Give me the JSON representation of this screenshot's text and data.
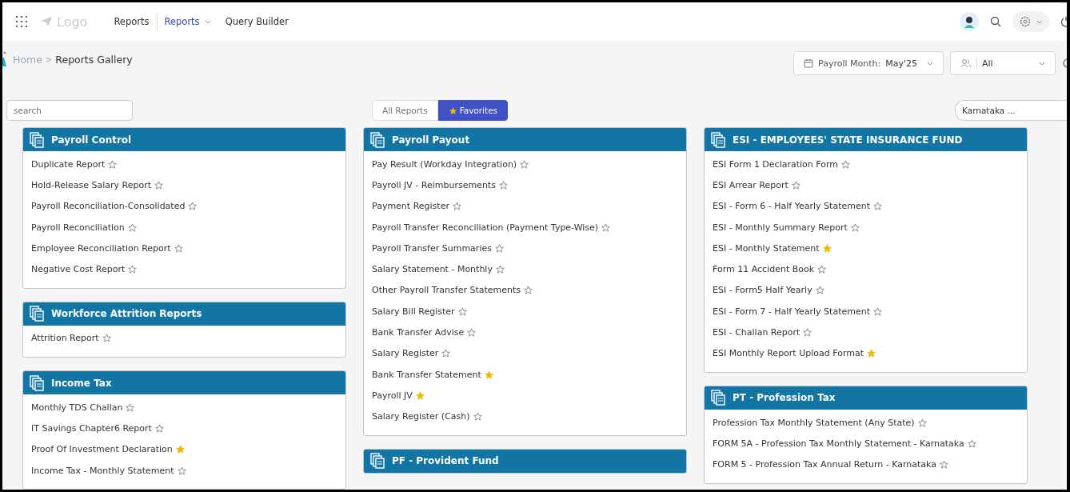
{
  "nav": {
    "logo": "Logo",
    "links": [
      {
        "label": "Reports",
        "selected": false,
        "dropdown": false
      },
      {
        "label": "Reports",
        "selected": true,
        "dropdown": true
      },
      {
        "label": "Query Builder",
        "selected": false,
        "dropdown": false
      }
    ]
  },
  "breadcrumb": {
    "home": "Home",
    "separator": ">",
    "current": "Reports Gallery"
  },
  "filters": {
    "payroll_month_label": "Payroll Month:",
    "payroll_month_value": "May'25",
    "group_value": "All"
  },
  "search": {
    "placeholder": "search"
  },
  "view_tabs": [
    {
      "label": "All Reports",
      "selected": false,
      "star": false
    },
    {
      "label": "Favorites",
      "selected": true,
      "star": true
    }
  ],
  "state_select": {
    "value": "Karnataka ..."
  },
  "columns": [
    [
      {
        "title": "Payroll Control",
        "items": [
          {
            "label": "Duplicate Report",
            "starred": false
          },
          {
            "label": "Hold-Release Salary Report",
            "starred": false
          },
          {
            "label": "Payroll Reconciliation-Consolidated",
            "starred": false
          },
          {
            "label": "Payroll Reconciliation",
            "starred": false
          },
          {
            "label": "Employee Reconciliation Report",
            "starred": false
          },
          {
            "label": "Negative Cost Report",
            "starred": false
          }
        ]
      },
      {
        "title": "Workforce Attrition Reports",
        "items": [
          {
            "label": "Attrition Report",
            "starred": false
          }
        ]
      },
      {
        "title": "Income Tax",
        "items": [
          {
            "label": "Monthly TDS Challan",
            "starred": false
          },
          {
            "label": "IT Savings Chapter6 Report",
            "starred": false
          },
          {
            "label": "Proof Of Investment Declaration",
            "starred": true
          },
          {
            "label": "Income Tax - Monthly Statement",
            "starred": false
          }
        ]
      }
    ],
    [
      {
        "title": "Payroll Payout",
        "items": [
          {
            "label": "Pay Result (Workday Integration)",
            "starred": false
          },
          {
            "label": "Payroll JV - Reimbursements",
            "starred": false
          },
          {
            "label": "Payment Register",
            "starred": false
          },
          {
            "label": "Payroll Transfer Reconciliation (Payment Type-Wise)",
            "starred": false
          },
          {
            "label": "Payroll Transfer Summaries",
            "starred": false
          },
          {
            "label": "Salary Statement - Monthly",
            "starred": false
          },
          {
            "label": "Other Payroll Transfer Statements",
            "starred": false
          },
          {
            "label": "Salary Bill Register",
            "starred": false
          },
          {
            "label": "Bank Transfer Advise",
            "starred": false
          },
          {
            "label": "Salary Register",
            "starred": false
          },
          {
            "label": "Bank Transfer Statement",
            "starred": true
          },
          {
            "label": "Payroll JV",
            "starred": true
          },
          {
            "label": "Salary Register (Cash)",
            "starred": false
          }
        ]
      },
      {
        "title": "PF - Provident Fund"
      }
    ],
    [
      {
        "title": "ESI - EMPLOYEES' STATE INSURANCE FUND",
        "items": [
          {
            "label": "ESI Form 1 Declaration Form",
            "starred": false
          },
          {
            "label": "ESI Arrear Report",
            "starred": false
          },
          {
            "label": "ESI - Form 6 - Half Yearly Statement",
            "starred": false
          },
          {
            "label": "ESI - Monthly Summary Report",
            "starred": false
          },
          {
            "label": "ESI - Monthly Statement",
            "starred": true
          },
          {
            "label": "Form 11 Accident Book",
            "starred": false
          },
          {
            "label": "ESI - Form5 Half Yearly",
            "starred": false
          },
          {
            "label": "ESI - Form 7 - Half Yearly Statement",
            "starred": false
          },
          {
            "label": "ESI - Challan Report",
            "starred": false
          },
          {
            "label": "ESI Monthly Report Upload Format",
            "starred": true
          }
        ]
      },
      {
        "title": "PT - Profession Tax",
        "items": [
          {
            "label": "Profession Tax Monthly Statement (Any State)",
            "starred": false
          },
          {
            "label": "FORM 5A - Profession Tax Monthly Statement - Karnataka",
            "starred": false
          },
          {
            "label": "FORM 5 - Profession Tax Annual Return - Karnataka",
            "starred": false
          }
        ]
      }
    ]
  ]
}
